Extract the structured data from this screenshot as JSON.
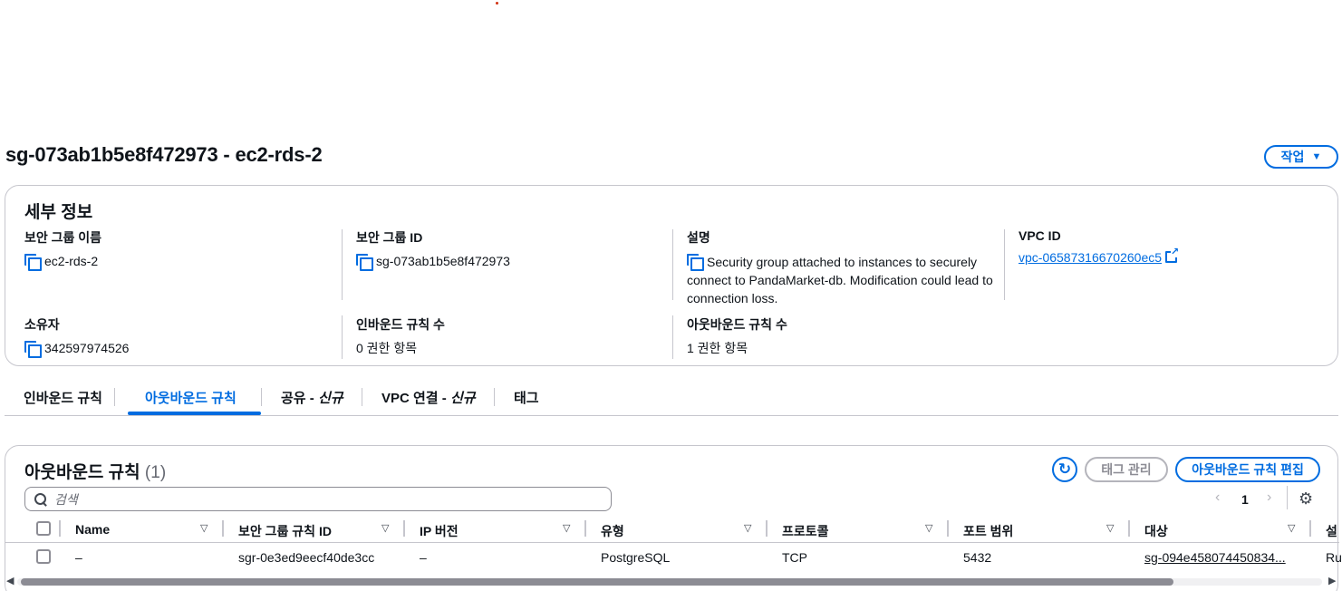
{
  "page": {
    "title": "sg-073ab1b5e8f472973 - ec2-rds-2",
    "actions_label": "작업"
  },
  "details": {
    "heading": "세부 정보",
    "fields": [
      {
        "label": "보안 그룹 이름",
        "value": "ec2-rds-2"
      },
      {
        "label": "보안 그룹 ID",
        "value": "sg-073ab1b5e8f472973"
      },
      {
        "label": "설명",
        "value": "Security group attached to instances to securely connect to PandaMarket-db. Modification could lead to connection loss."
      },
      {
        "label": "VPC ID",
        "value": "vpc-06587316670260ec5"
      },
      {
        "label": "소유자",
        "value": "342597974526"
      },
      {
        "label": "인바운드 규칙 수",
        "value": "0 권한 항목"
      },
      {
        "label": "아웃바운드 규칙 수",
        "value": "1 권한 항목"
      }
    ]
  },
  "tabs": [
    {
      "label": "인바운드 규칙"
    },
    {
      "label": "아웃바운드 규칙",
      "active": true
    },
    {
      "label": "공유 - ",
      "badge": "신규"
    },
    {
      "label": "VPC 연결 - ",
      "badge": "신규"
    },
    {
      "label": "태그"
    }
  ],
  "rules": {
    "heading": "아웃바운드 규칙",
    "count": "(1)",
    "manage_tags_label": "태그 관리",
    "edit_label": "아웃바운드 규칙 편집",
    "search_placeholder": "검색",
    "page_number": "1",
    "columns": [
      "Name",
      "보안 그룹 규칙 ID",
      "IP 버전",
      "유형",
      "프로토콜",
      "포트 범위",
      "대상",
      "설"
    ],
    "rows": [
      [
        "–",
        "sgr-0e3ed9eecf40de3cc",
        "–",
        "PostgreSQL",
        "TCP",
        "5432",
        "sg-094e458074450834...",
        "Ru"
      ]
    ]
  },
  "colors": {
    "accent": "#006ce0",
    "text": "#0f141a",
    "border": "#c6c6cd"
  }
}
